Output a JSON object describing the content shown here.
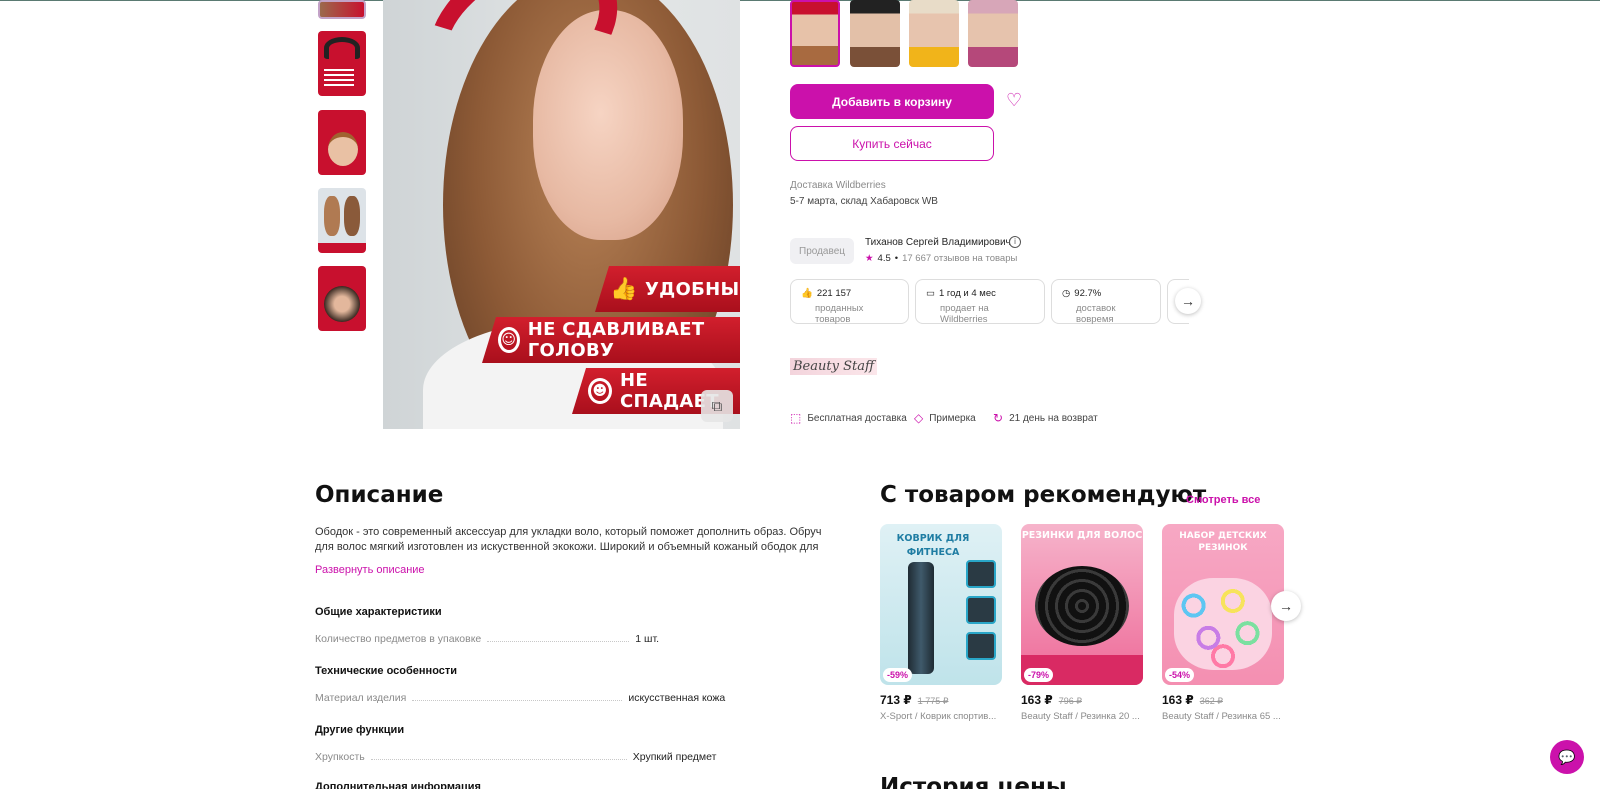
{
  "main_photo": {
    "banners": [
      {
        "icon": "thumbs-up-icon",
        "text": "УДОБНЫЙ"
      },
      {
        "icon": "head-icon",
        "text": "НЕ СДАВЛИВАЕТ ГОЛОВУ"
      },
      {
        "icon": "hair-icon",
        "text": "НЕ СПАДАЕТ"
      }
    ]
  },
  "actions": {
    "add_to_cart": "Добавить в корзину",
    "buy_now": "Купить сейчас"
  },
  "delivery": {
    "title": "Доставка Wildberries",
    "details": "5-7 марта, склад Хабаровск WB"
  },
  "seller": {
    "badge": "Продавец",
    "name": "Тиханов Сергей Владимирович",
    "rating": "4.5",
    "reviews": "17 667 отзывов на товары"
  },
  "stats": [
    {
      "icon": "thumbs-up-icon",
      "value": "221 157",
      "label": "проданных товаров"
    },
    {
      "icon": "box-icon",
      "value": "1 год и 4 мес",
      "label": "продает на Wildberries"
    },
    {
      "icon": "clock-icon",
      "value": "92.7%",
      "label": "доставок вовремя"
    }
  ],
  "brand_logo": "Beauty Staff",
  "features": [
    {
      "icon": "box-icon",
      "text": "Бесплатная доставка"
    },
    {
      "icon": "tag-icon",
      "text": "Примерка"
    },
    {
      "icon": "refresh-icon",
      "text": "21 день на возврат"
    }
  ],
  "description": {
    "heading": "Описание",
    "text": "Ободок - это современный аксессуар для укладки воло, который поможет дополнить образ. Обруч для волос мягкий изготовлен из искуственной экокожи. Широкий и объемный кожаный ободок для волос",
    "expand_link": "Развернуть описание"
  },
  "specs": [
    {
      "section": "Общие характеристики",
      "key": "Количество предметов в упаковке",
      "value": "1 шт."
    },
    {
      "section": "Технические особенности",
      "key": "Материал изделия",
      "value": "искусственная кожа"
    },
    {
      "section": "Другие функции",
      "key": "Хрупкость",
      "value": "Хрупкий предмет"
    }
  ],
  "next_section": "Дополнительная информация",
  "recommendations": {
    "heading": "С товаром рекомендуют",
    "see_all": "Смотреть все",
    "items": [
      {
        "image_title": "КОВРИК ДЛЯ ФИТНЕСА",
        "discount": "-59%",
        "price": "713 ₽",
        "old_price": "1 775 ₽",
        "name": "X-Sport / Коврик спортив..."
      },
      {
        "image_title": "РЕЗИНКИ ДЛЯ ВОЛОС",
        "discount": "-79%",
        "price": "163 ₽",
        "old_price": "796 ₽",
        "name": "Beauty Staff / Резинка 20 ..."
      },
      {
        "image_title": "НАБОР ДЕТСКИХ РЕЗИНОК",
        "discount": "-54%",
        "price": "163 ₽",
        "old_price": "362 ₽",
        "name": "Beauty Staff / Резинка 65 ..."
      }
    ]
  },
  "price_history_heading": "История цены",
  "colors": {
    "accent": "#cb11ab",
    "banner_red": "#c8102e"
  }
}
